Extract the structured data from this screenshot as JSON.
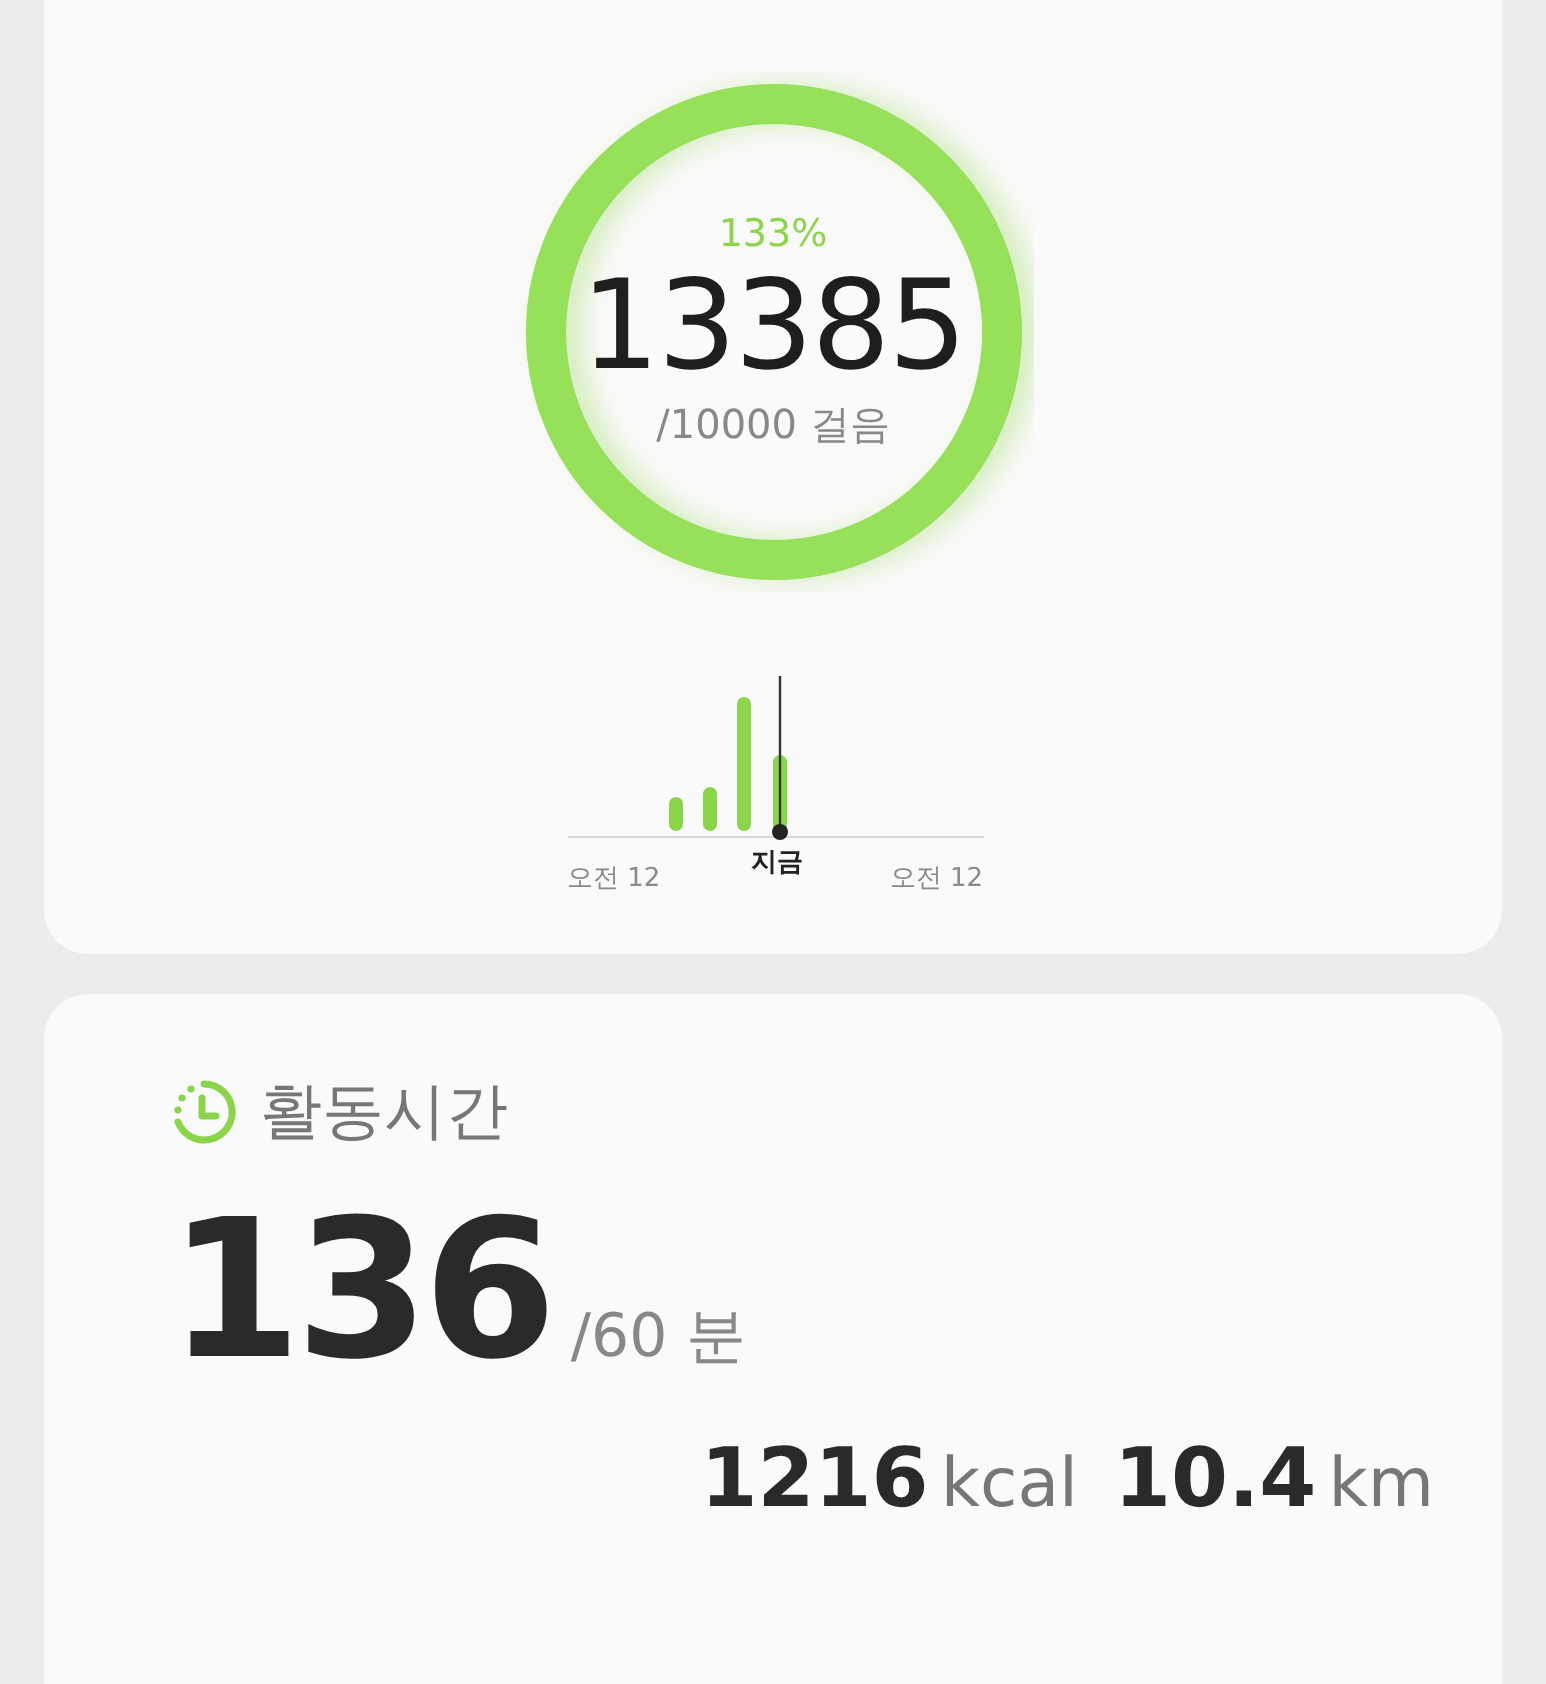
{
  "steps": {
    "percent": "133%",
    "count": "13385",
    "goal": "/10000 걸음",
    "level": 1
  },
  "step_chart": {
    "left_label": "오전 12",
    "now_label": "지금",
    "right_label": "오전 12"
  },
  "activity": {
    "title": "활동시간",
    "value": "136",
    "goal": "/60 분",
    "stats": [
      {
        "value": "1216",
        "unit": "kcal"
      },
      {
        "value": "10.4",
        "unit": "km"
      }
    ]
  }
}
